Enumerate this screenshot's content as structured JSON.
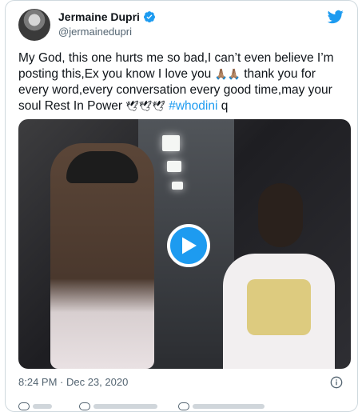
{
  "tweet": {
    "author": {
      "name": "Jermaine Dupri",
      "handle": "@jermainedupri",
      "verified": true
    },
    "text_parts": {
      "before_emoji": "My God, this one hurts me so bad,I can’t even believe I’m posting this,Ex you know I love you ",
      "emoji_pray": "🙏🏽🙏🏽",
      "after_emoji": " thank you for every word,every conversation every good time,may your soul Rest In Power ",
      "emoji_doves": "🕊🕊🕊",
      "hashtag": "#whodini",
      "trailing": " q"
    },
    "timestamp": "8:24 PM · Dec 23, 2020"
  },
  "icons": {
    "logo": "twitter-bird-icon",
    "verified": "verified-badge-icon",
    "play": "play-icon",
    "info": "info-icon"
  },
  "colors": {
    "accent": "#1d9bf0",
    "text": "#0f1419",
    "secondary": "#536471",
    "border": "#cfd9de"
  }
}
